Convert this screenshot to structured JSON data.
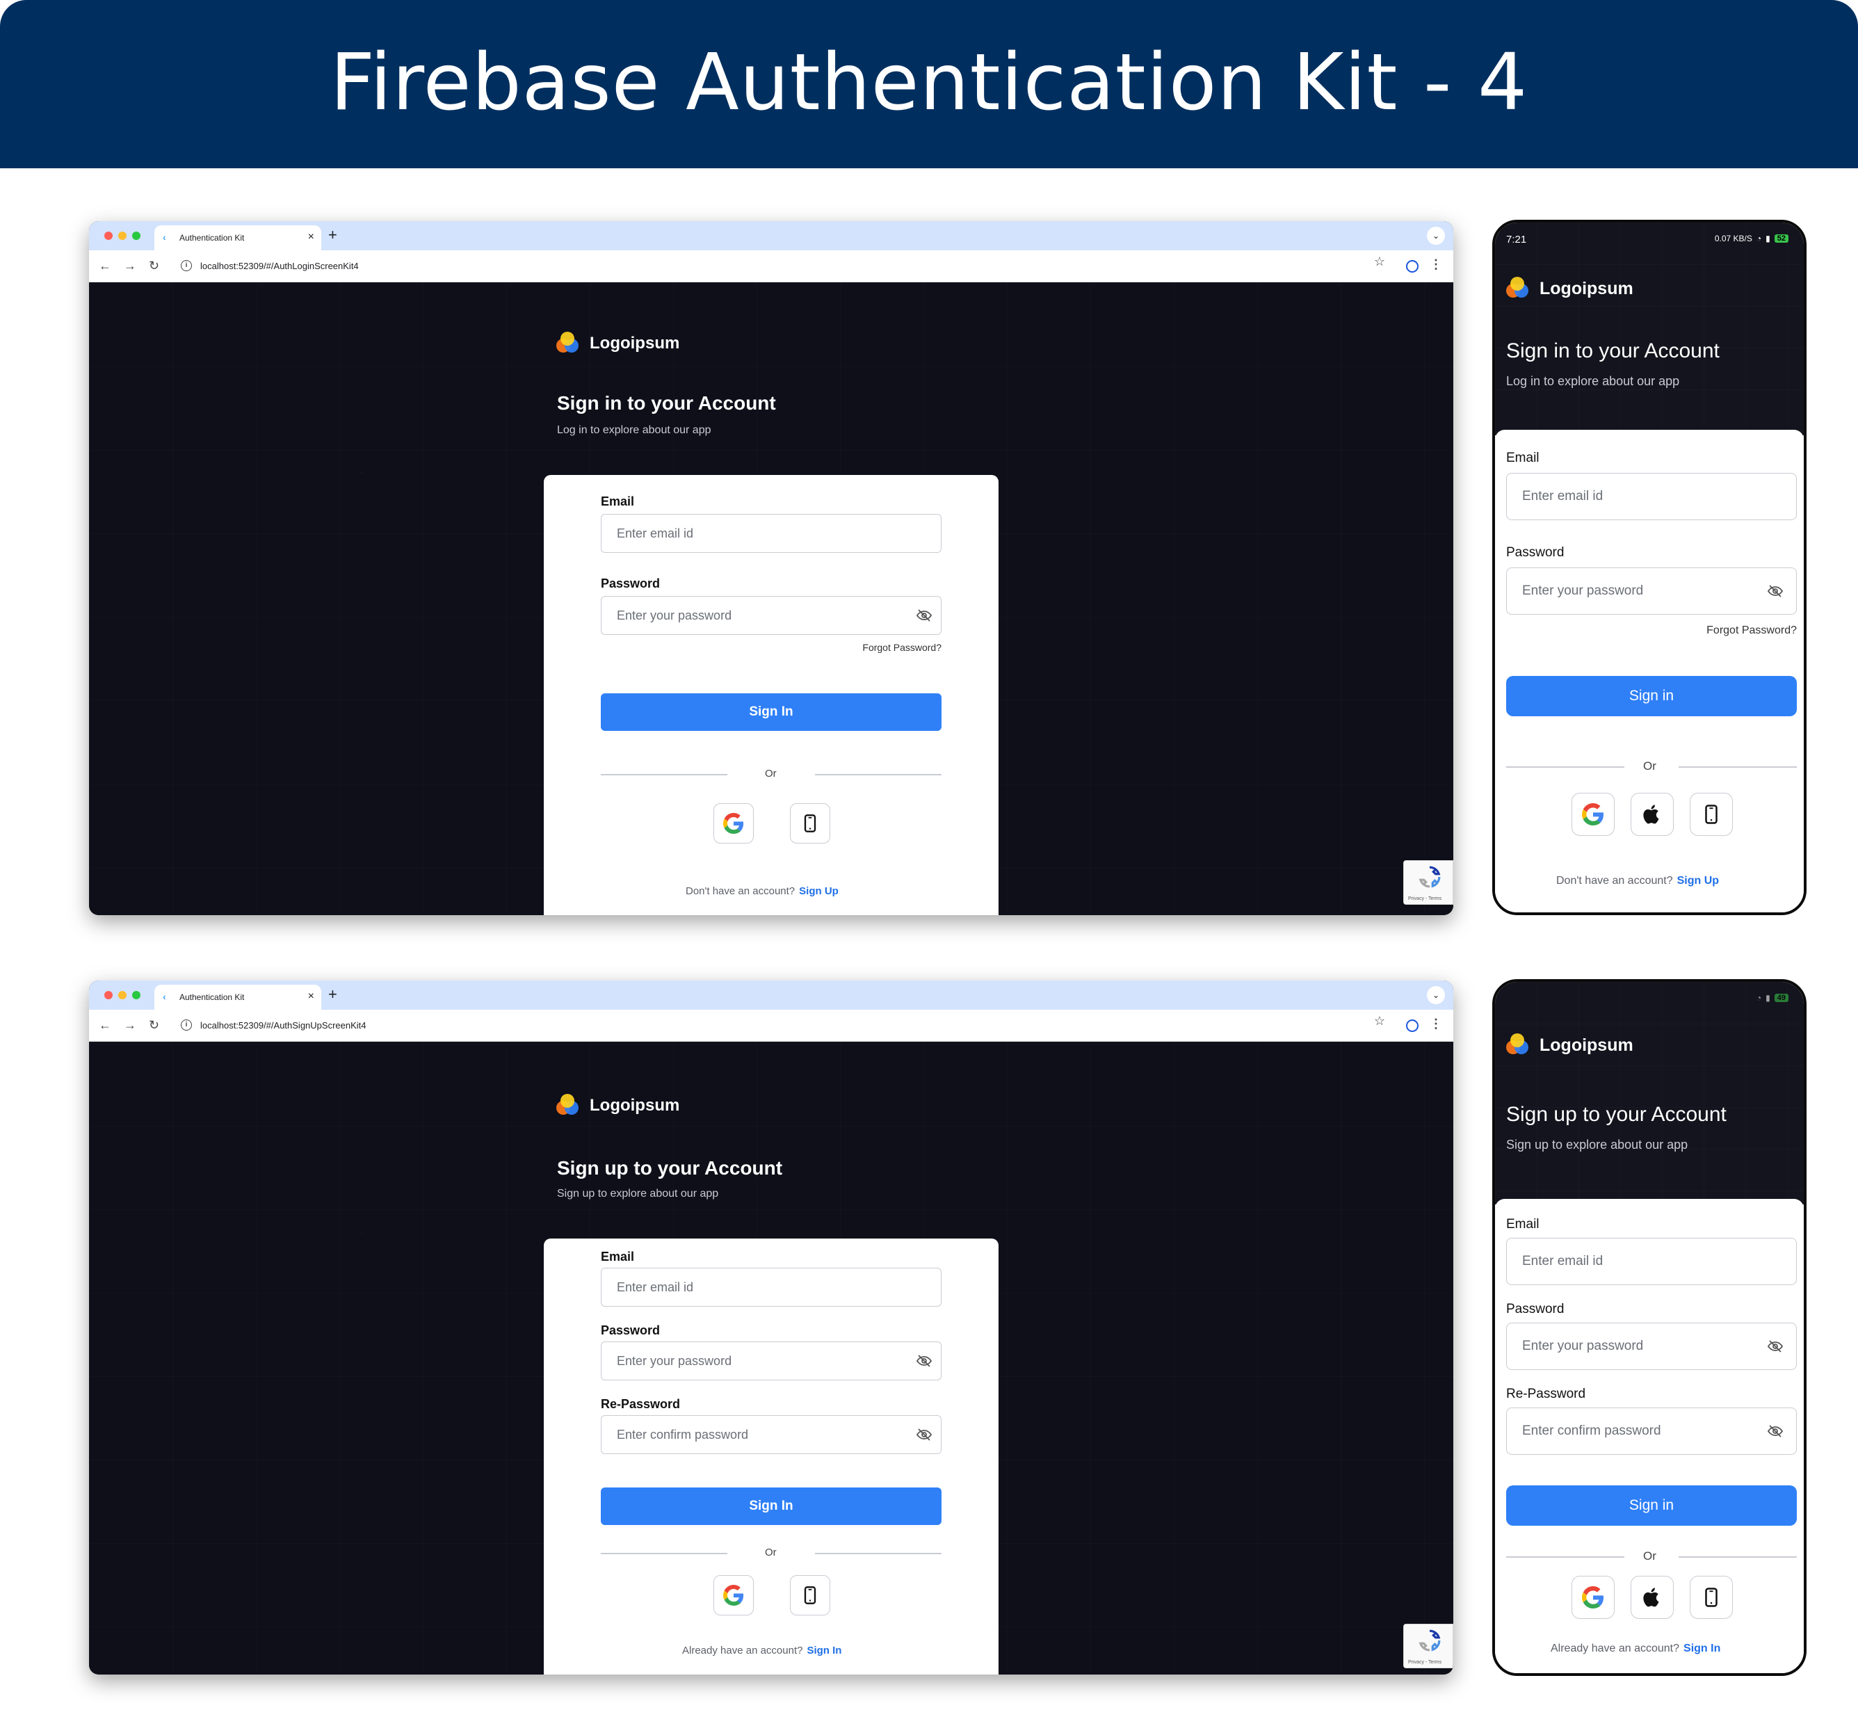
{
  "banner": {
    "title": "Firebase Authentication Kit - 4"
  },
  "browser_common": {
    "tab_title": "Authentication Kit",
    "tab_close": "×",
    "new_tab": "+",
    "tab_menu": "⌄",
    "back": "←",
    "forward": "→",
    "reload": "↻",
    "star": "☆",
    "kebab": "⋮",
    "recaptcha_terms": "Privacy - Terms"
  },
  "brand": {
    "logo_text": "Logoipsum",
    "logo_text_mobile": "Logoipsum"
  },
  "login_web": {
    "url": "localhost:52309/#/AuthLoginScreenKit4",
    "heading": "Sign in to your Account",
    "subheading": "Log in to explore about our app",
    "email_label": "Email",
    "email_placeholder": "Enter email id",
    "password_label": "Password",
    "password_placeholder": "Enter your password",
    "forgot": "Forgot Password?",
    "button": "Sign In",
    "or": "Or",
    "footer_text": "Don't have an account?",
    "footer_link": "Sign Up"
  },
  "login_mobile": {
    "status_time": "7:21",
    "status_net": "0.07 KB/S",
    "battery": "52",
    "heading": "Sign in to your Account",
    "subheading": "Log in to explore about our app",
    "email_label": "Email",
    "email_placeholder": "Enter email id",
    "password_label": "Password",
    "password_placeholder": "Enter your password",
    "forgot": "Forgot Password?",
    "button": "Sign in",
    "or": "Or",
    "footer_text": "Don't have an account?",
    "footer_link": "Sign Up"
  },
  "signup_web": {
    "url": "localhost:52309/#/AuthSignUpScreenKit4",
    "heading": "Sign up to your Account",
    "subheading": "Sign up to explore about our app",
    "email_label": "Email",
    "email_placeholder": "Enter email id",
    "password_label": "Password",
    "password_placeholder": "Enter your password",
    "repassword_label": "Re-Password",
    "repassword_placeholder": "Enter confirm password",
    "button": "Sign In",
    "or": "Or",
    "footer_text": "Already have an account?",
    "footer_link": "Sign In"
  },
  "signup_mobile": {
    "battery": "49",
    "heading": "Sign up to your Account",
    "subheading": "Sign up to explore about our app",
    "email_label": "Email",
    "email_placeholder": "Enter email id",
    "password_label": "Password",
    "password_placeholder": "Enter your password",
    "repassword_label": "Re-Password",
    "repassword_placeholder": "Enter confirm password",
    "button": "Sign in",
    "or": "Or",
    "footer_text": "Already have an account?",
    "footer_link": "Sign In"
  },
  "colors": {
    "banner": "#002f5f",
    "accent": "#2f80f7",
    "dark_bg": "#0e0f19",
    "link": "#1f6fe6"
  },
  "icons": [
    "google-icon",
    "apple-icon",
    "phone-icon",
    "eye-off-icon",
    "recaptcha-icon",
    "logo-icon"
  ]
}
